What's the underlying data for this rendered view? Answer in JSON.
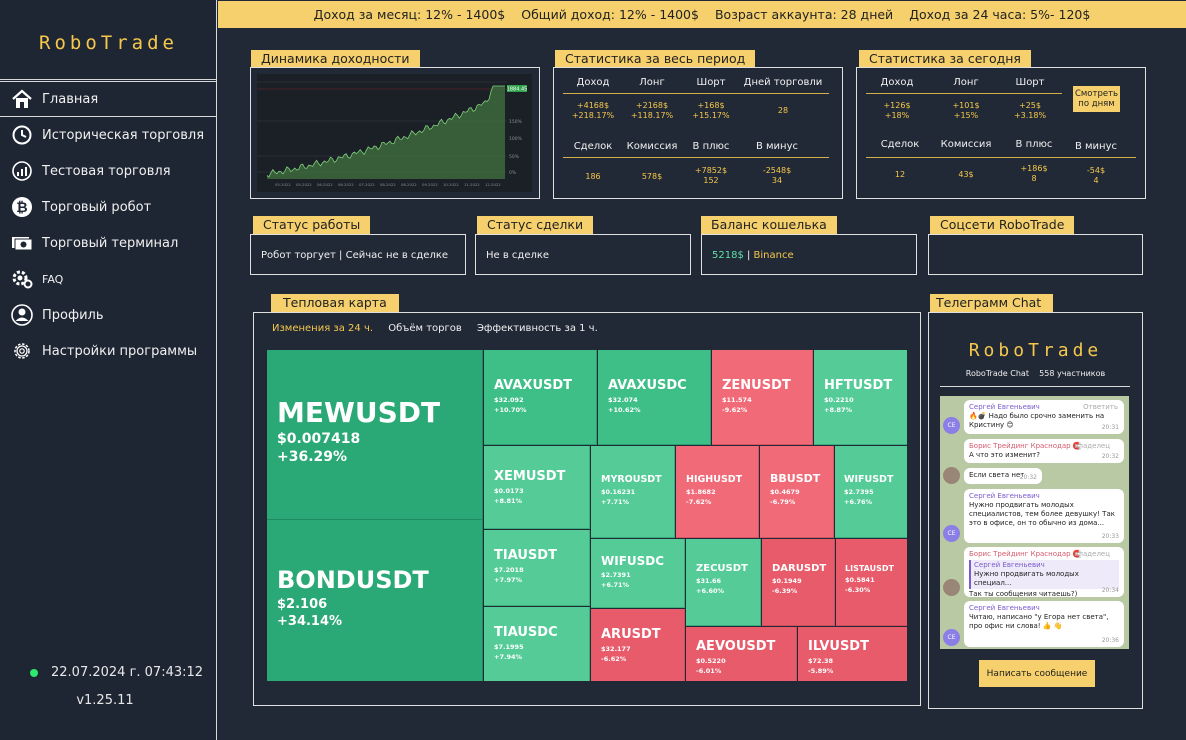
{
  "app": {
    "logo": "RoboTrade",
    "datetime": "22.07.2024 г. 07:43:12",
    "version": "v1.25.11"
  },
  "banner": {
    "month": "Доход за месяц: 12% - 1400$",
    "total": "Общий доход: 12% - 1400$",
    "age": "Возраст аккаунта: 28 дней",
    "day": "Доход за 24 часа: 5%- 120$"
  },
  "sidebar": {
    "items": [
      {
        "label": "Главная",
        "icon": "home-icon"
      },
      {
        "label": "Историческая торговля",
        "icon": "history-icon"
      },
      {
        "label": "Тестовая торговля",
        "icon": "test-icon"
      },
      {
        "label": "Торговый робот",
        "icon": "bitcoin-icon"
      },
      {
        "label": "Торговый терминал",
        "icon": "terminal-icon"
      },
      {
        "label": "FAQ",
        "icon": "faq-icon"
      },
      {
        "label": "Профиль",
        "icon": "profile-icon"
      },
      {
        "label": "Настройки программы",
        "icon": "settings-icon"
      }
    ]
  },
  "panels": {
    "profit_chart": "Динамика доходности",
    "stats_all": "Статистика за весь период",
    "stats_today": "Статистика за сегодня",
    "work_status": "Статус работы",
    "deal_status": "Статус сделки",
    "wallet": "Баланс кошелька",
    "social": "Соцсети RoboTrade",
    "heatmap": "Тепловая карта",
    "telegram": "Телеграмм Chat"
  },
  "profit_chart": {
    "last_label": "1884.45",
    "y_ticks": [
      "150%",
      "100%",
      "50%",
      "0%"
    ],
    "x_ticks": [
      "05.2022",
      "05.2022",
      "06.2022",
      "06.2022",
      "07.2022",
      "08.2022",
      "08.2022",
      "09.2022",
      "10.2022",
      "11.2022",
      "12.2022"
    ]
  },
  "stats_all": {
    "headers1": [
      "Доход",
      "Лонг",
      "Шорт",
      "Дней торговли"
    ],
    "row1": [
      [
        "+4168$",
        "+218.17%"
      ],
      [
        "+2168$",
        "+118.17%"
      ],
      [
        "+168$",
        "+15.17%"
      ],
      [
        "28",
        ""
      ]
    ],
    "headers2": [
      "Сделок",
      "Комиссия",
      "В плюс",
      "В минус"
    ],
    "row2": [
      [
        "186",
        ""
      ],
      [
        "578$",
        ""
      ],
      [
        "+7852$",
        "152"
      ],
      [
        "-2548$",
        "34"
      ]
    ]
  },
  "stats_today": {
    "headers1": [
      "Доход",
      "Лонг",
      "Шорт"
    ],
    "row1": [
      [
        "+126$",
        "+18%"
      ],
      [
        "+101$",
        "+15%"
      ],
      [
        "+25$",
        "+3.18%"
      ]
    ],
    "button": [
      "Смотреть",
      "по дням"
    ],
    "headers2": [
      "Сделок",
      "Комиссия",
      "В плюс",
      "В минус"
    ],
    "row2": [
      [
        "12",
        ""
      ],
      [
        "43$",
        ""
      ],
      [
        "+186$",
        "8"
      ],
      [
        "-54$",
        "4"
      ]
    ]
  },
  "status": {
    "work": "Робот торгует | Сейчас не в сделке",
    "deal": "Не в сделке",
    "wallet_amount": "5218$",
    "wallet_sep": " | ",
    "wallet_exchange": "Binance"
  },
  "heatmap": {
    "tabs": [
      "Изменения за 24 ч.",
      "Объём торгов",
      "Эффективность за 1 ч."
    ],
    "cells": [
      {
        "name": "MEWUSDT",
        "price": "$0.007418",
        "change": "+36.29%"
      },
      {
        "name": "BONDUSDT",
        "price": "$2.106",
        "change": "+34.14%"
      },
      {
        "name": "AVAXUSDT",
        "price": "$32.092",
        "change": "+10.70%"
      },
      {
        "name": "AVAXUSDC",
        "price": "$32.074",
        "change": "+10.62%"
      },
      {
        "name": "ZENUSDT",
        "price": "$11.574",
        "change": "-9.62%"
      },
      {
        "name": "HFTUSDT",
        "price": "$0.2210",
        "change": "+8.87%"
      },
      {
        "name": "XEMUSDT",
        "price": "$0.0173",
        "change": "+8.81%"
      },
      {
        "name": "MYROUSDT",
        "price": "$0.16231",
        "change": "+7.71%"
      },
      {
        "name": "HIGHUSDT",
        "price": "$1.8682",
        "change": "-7.62%"
      },
      {
        "name": "BBUSDT",
        "price": "$0.4679",
        "change": "-6.79%"
      },
      {
        "name": "WIFUSDT",
        "price": "$2.7395",
        "change": "+6.76%"
      },
      {
        "name": "TIAUSDT",
        "price": "$7.2018",
        "change": "+7.97%"
      },
      {
        "name": "WIFUSDC",
        "price": "$2.7391",
        "change": "+6.71%"
      },
      {
        "name": "ZECUSDT",
        "price": "$31.66",
        "change": "+6.60%"
      },
      {
        "name": "DARUSDT",
        "price": "$0.1949",
        "change": "-6.39%"
      },
      {
        "name": "LISTAUSDT",
        "price": "$0.5841",
        "change": "-6.30%"
      },
      {
        "name": "TIAUSDC",
        "price": "$7.1995",
        "change": "+7.94%"
      },
      {
        "name": "ARUSDT",
        "price": "$32.177",
        "change": "-6.62%"
      },
      {
        "name": "AEVOUSDT",
        "price": "$0.5220",
        "change": "-6.01%"
      },
      {
        "name": "ILVUSDT",
        "price": "$72.38",
        "change": "-5.89%"
      }
    ]
  },
  "telegram": {
    "logo": "RoboTrade",
    "chat_name": "RoboTrade Chat",
    "members": "558 участников",
    "messages": [
      {
        "author": "Сергей Евгеньевич",
        "reply": "Ответить",
        "text": "🔥💣 Надо было срочно заменить на Кристину 😊",
        "time": "20:31",
        "avatar": "СЕ"
      },
      {
        "author": "Борис Трейдинг Краснодар 🧲",
        "role": "владелец",
        "text": "А что это изменит?",
        "time": "20:32",
        "avatar": ""
      },
      {
        "author": "",
        "text": "Если света нет",
        "time": "20:32",
        "avatar": ""
      },
      {
        "author": "Сергей Евгеньевич",
        "text": "Нужно продвигать молодых специалистов, тем более девушку! Так это в офисе, он то обычно из дома...",
        "time": "20:33",
        "avatar": "СЕ"
      },
      {
        "author": "Борис Трейдинг Краснодар 🧲",
        "role": "владелец",
        "quote_author": "Сергей Евгеньевич",
        "quote": "Нужно продвигать молодых специал...",
        "text": "Так ты сообщения читаешь?)",
        "time": "20:34",
        "avatar": ""
      },
      {
        "author": "Сергей Евгеньевич",
        "text": "Читаю, написано \"у Егора нет света\", про офис ни слова! 👍 👋",
        "time": "20:36",
        "avatar": "СЕ"
      }
    ],
    "button": "Написать сообщение"
  }
}
